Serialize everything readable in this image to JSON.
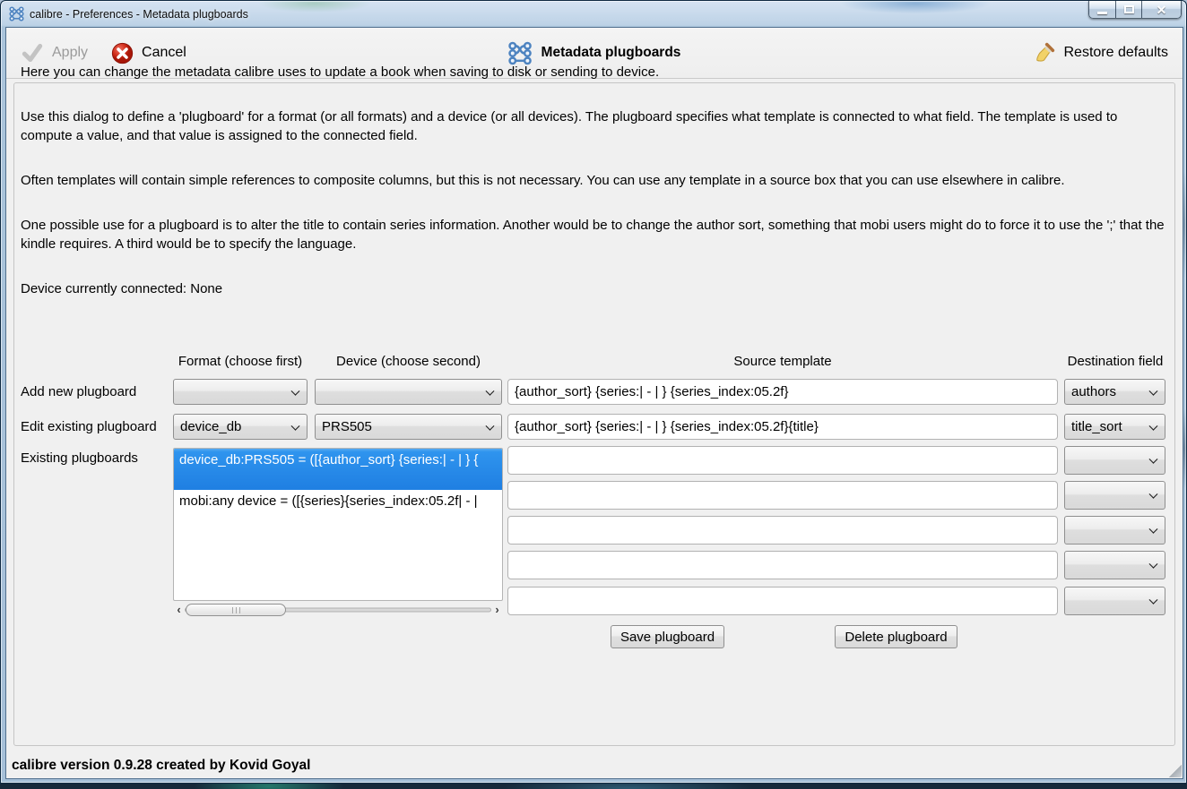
{
  "window": {
    "title": "calibre - Preferences - Metadata plugboards"
  },
  "toolbar": {
    "apply_label": "Apply",
    "cancel_label": "Cancel",
    "center_title": "Metadata plugboards",
    "restore_label": "Restore defaults"
  },
  "intro": {
    "p1": "Here you can change the metadata calibre uses to update a book when saving to disk or sending to device.",
    "p2": "Use this dialog to define a 'plugboard' for a format (or all formats) and a device (or all devices). The plugboard specifies what template is connected to what field. The template is used to compute a value, and that value is assigned to the connected field.",
    "p3": "Often templates will contain simple references to composite columns, but this is not necessary. You can use any template in a source box that you can use elsewhere in calibre.",
    "p4": "One possible use for a plugboard is to alter the title to contain series information. Another would be to change the author sort, something that mobi users might do to force it to use the ';' that the kindle requires. A third would be to specify the language.",
    "device_line": "Device currently connected: None"
  },
  "table": {
    "headers": {
      "format": "Format (choose first)",
      "device": "Device (choose second)",
      "source": "Source template",
      "dest": "Destination field"
    },
    "add_row": {
      "label": "Add new plugboard",
      "format_value": "",
      "device_value": "",
      "source_value": "{author_sort} {series:| - | } {series_index:05.2f}",
      "dest_value": "authors"
    },
    "edit_row": {
      "label": "Edit existing plugboard",
      "format_value": "device_db",
      "device_value": "PRS505",
      "source_value": "{author_sort} {series:| - | } {series_index:05.2f}{title}",
      "dest_value": "title_sort"
    },
    "existing_label": "Existing plugboards",
    "existing_items": [
      {
        "text": "device_db:PRS505 = ([{author_sort} {series:| - | } {",
        "selected": true
      },
      {
        "text": "mobi:any device = ([{series}{series_index:05.2f| - |",
        "selected": false
      }
    ],
    "save_label": "Save plugboard",
    "delete_label": "Delete plugboard"
  },
  "footer": {
    "version_line": "calibre version 0.9.28 created by Kovid Goyal"
  }
}
